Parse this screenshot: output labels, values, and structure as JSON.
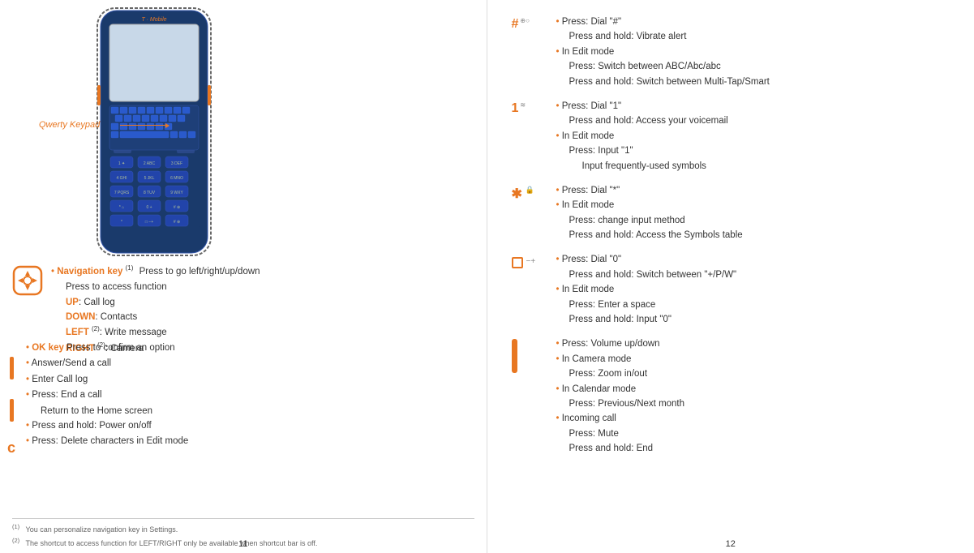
{
  "pages": {
    "left": {
      "number": "11",
      "qwerty_label": "Qwerty Keypad",
      "phone_brand": "T · Mobile",
      "navigation_key": {
        "label": "Navigation key",
        "superscript": "(1)",
        "items": [
          {
            "text": "Press to go left/right/up/down",
            "level": "indent"
          },
          {
            "text": "Press to access function",
            "level": "indent"
          },
          {
            "text": "UP: Call log",
            "level": "indent"
          },
          {
            "text": "DOWN: Contacts",
            "level": "indent"
          },
          {
            "text": "LEFT (2): Write message",
            "level": "indent"
          },
          {
            "text": "RIGHT (2): Camera",
            "level": "indent"
          }
        ]
      },
      "bullets": [
        {
          "text": "OK key Press to confirm an option",
          "level": "top"
        },
        {
          "text": "Answer/Send a call",
          "level": "top"
        },
        {
          "text": "Enter Call log",
          "level": "top"
        },
        {
          "text": "Press: End a call",
          "level": "top"
        },
        {
          "text": "Return to the Home screen",
          "level": "indent"
        },
        {
          "text": "Press and hold: Power on/off",
          "level": "top"
        },
        {
          "text": "Press: Delete characters in Edit mode",
          "level": "top"
        }
      ],
      "footnotes": [
        "(1)    You can personalize navigation key in Settings.",
        "(2)    The shortcut to access function for LEFT/RIGHT only be available when shortcut bar is off."
      ]
    },
    "right": {
      "number": "12",
      "sections": [
        {
          "icon": "#",
          "icon_sub": "⊕○",
          "bullets": [
            {
              "text": "Press: Dial \"#\"",
              "level": "top"
            },
            {
              "text": "Press and hold: Vibrate alert",
              "level": "sub"
            },
            {
              "text": "In Edit mode",
              "level": "top"
            },
            {
              "text": "Press: Switch between ABC/Abc/abc",
              "level": "sub"
            },
            {
              "text": "Press and hold: Switch between Multi-Tap/Smart",
              "level": "sub"
            }
          ]
        },
        {
          "icon": "1",
          "icon_sub": "≋",
          "bullets": [
            {
              "text": "Press: Dial \"1\"",
              "level": "top"
            },
            {
              "text": "Press and hold: Access your voicemail",
              "level": "sub"
            },
            {
              "text": "In Edit mode",
              "level": "top"
            },
            {
              "text": "Press: Input \"1\"",
              "level": "sub"
            },
            {
              "text": "Input frequently-used symbols",
              "level": "sub2"
            }
          ]
        },
        {
          "icon": "✱",
          "icon_sub": "🔒",
          "bullets": [
            {
              "text": "Press: Dial \"*\"",
              "level": "top"
            },
            {
              "text": "In Edit mode",
              "level": "top"
            },
            {
              "text": "Press: change input method",
              "level": "sub"
            },
            {
              "text": "Press and hold: Access the Symbols table",
              "level": "sub"
            }
          ]
        },
        {
          "icon": "□",
          "icon_sub": "−+",
          "bullets": [
            {
              "text": "Press: Dial \"0\"",
              "level": "top"
            },
            {
              "text": "Press and hold: Switch between \"+/P/W\"",
              "level": "sub"
            },
            {
              "text": "In Edit mode",
              "level": "top"
            },
            {
              "text": "Press: Enter a space",
              "level": "sub"
            },
            {
              "text": "Press and hold: Input \"0\"",
              "level": "sub"
            }
          ]
        },
        {
          "icon": "vol",
          "icon_sub": "",
          "bullets": [
            {
              "text": "Press: Volume up/down",
              "level": "top"
            },
            {
              "text": "In Camera mode",
              "level": "top"
            },
            {
              "text": "Press: Zoom in/out",
              "level": "sub"
            },
            {
              "text": "In Calendar mode",
              "level": "top"
            },
            {
              "text": "Press: Previous/Next month",
              "level": "sub"
            },
            {
              "text": "Incoming call",
              "level": "top"
            },
            {
              "text": "Press: Mute",
              "level": "sub"
            },
            {
              "text": "Press and hold: End",
              "level": "sub"
            }
          ]
        }
      ]
    }
  }
}
